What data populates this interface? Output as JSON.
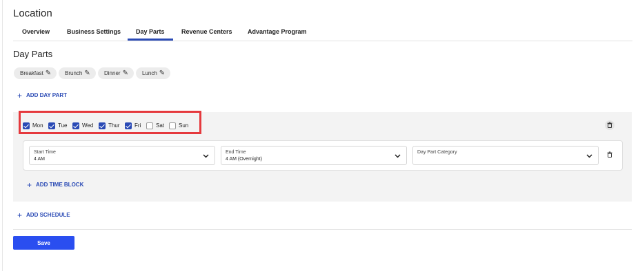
{
  "page": {
    "title": "Location"
  },
  "tabs": [
    {
      "label": "Overview"
    },
    {
      "label": "Business Settings"
    },
    {
      "label": "Day Parts"
    },
    {
      "label": "Revenue Centers"
    },
    {
      "label": "Advantage Program"
    }
  ],
  "active_tab": "Day Parts",
  "section": {
    "title": "Day Parts"
  },
  "day_part_chips": [
    {
      "label": "Breakfast",
      "icon": "pencil-icon"
    },
    {
      "label": "Brunch",
      "icon": "pencil-icon"
    },
    {
      "label": "Dinner",
      "icon": "pencil-icon"
    },
    {
      "label": "Lunch",
      "icon": "pencil-icon"
    }
  ],
  "add_day_part_label": "ADD DAY PART",
  "schedule": {
    "days": [
      {
        "label": "Mon",
        "checked": true
      },
      {
        "label": "Tue",
        "checked": true
      },
      {
        "label": "Wed",
        "checked": true
      },
      {
        "label": "Thur",
        "checked": true
      },
      {
        "label": "Fri",
        "checked": true
      },
      {
        "label": "Sat",
        "checked": false
      },
      {
        "label": "Sun",
        "checked": false
      }
    ],
    "time_block": {
      "start_time": {
        "label": "Start Time",
        "value": "4 AM"
      },
      "end_time": {
        "label": "End Time",
        "value": "4 AM (Overnight)"
      },
      "category": {
        "label": "Day Part Category",
        "value": ""
      }
    },
    "add_time_block_label": "ADD TIME BLOCK"
  },
  "add_schedule_label": "ADD SCHEDULE",
  "save_label": "Save",
  "colors": {
    "accent": "#2a4ab5",
    "button": "#2a4ef0",
    "highlight": "#e5393d",
    "panel": "#f3f3f3"
  }
}
